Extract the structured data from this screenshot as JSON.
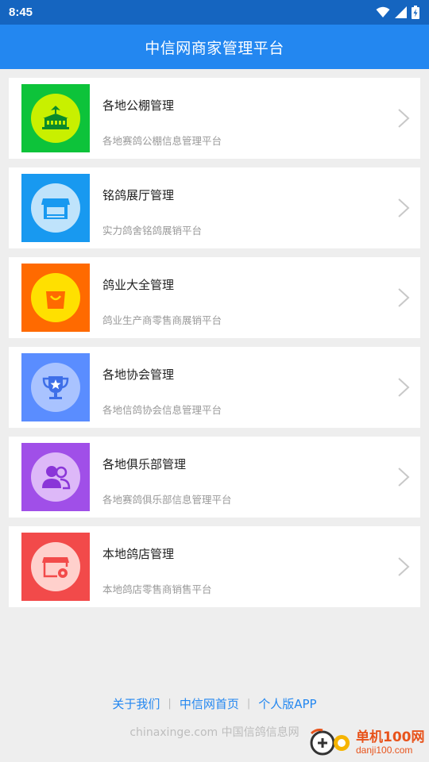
{
  "status_bar": {
    "time": "8:45"
  },
  "app_bar": {
    "title": "中信网商家管理平台"
  },
  "items": [
    {
      "title": "各地公棚管理",
      "subtitle": "各地赛鸽公棚信息管理平台",
      "icon": "loft-building-icon",
      "tile_color": "#0dc33a",
      "circle_color": "#c8f000",
      "glyph_color": "#0a8a2a"
    },
    {
      "title": "铭鸽展厅管理",
      "subtitle": "实力鸽舍铭鸽展销平台",
      "icon": "store-icon",
      "tile_color": "#1899f0",
      "circle_color": "#bfe3fb",
      "glyph_color": "#1899f0"
    },
    {
      "title": "鸽业大全管理",
      "subtitle": "鸽业生产商零售商展销平台",
      "icon": "shopping-bag-icon",
      "tile_color": "#ff6a00",
      "circle_color": "#ffe000",
      "glyph_color": "#ff6a00"
    },
    {
      "title": "各地协会管理",
      "subtitle": "各地信鸽协会信息管理平台",
      "icon": "trophy-icon",
      "tile_color": "#5a8dff",
      "circle_color": "#a9c3ff",
      "glyph_color": "#3e6fe8"
    },
    {
      "title": "各地俱乐部管理",
      "subtitle": "各地赛鸽俱乐部信息管理平台",
      "icon": "users-icon",
      "tile_color": "#a04fe8",
      "circle_color": "#ddb8f8",
      "glyph_color": "#8a35d8"
    },
    {
      "title": "本地鸽店管理",
      "subtitle": "本地鸽店零售商销售平台",
      "icon": "shop-settings-icon",
      "tile_color": "#f24a4a",
      "circle_color": "#ffd0cc",
      "glyph_color": "#f24a4a"
    }
  ],
  "footer": {
    "links": [
      "关于我们",
      "中信网首页",
      "个人版APP"
    ],
    "separator": "|",
    "copyright": "chinaxinge.com 中国信鸽信息网"
  },
  "watermark": {
    "brand": "单机100网",
    "url": "danji100.com"
  }
}
